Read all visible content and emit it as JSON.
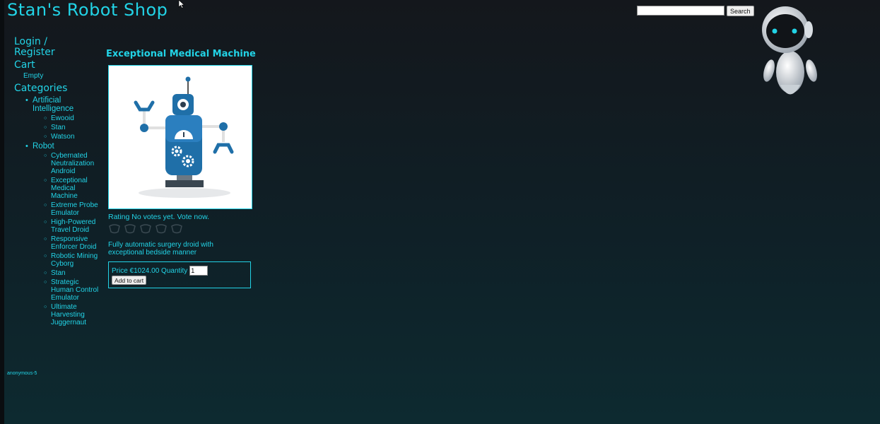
{
  "header": {
    "site_title": "Stan's Robot Shop",
    "search_placeholder": "",
    "search_button": "Search"
  },
  "sidebar": {
    "login": "Login / Register",
    "cart_label": "Cart",
    "cart_status": "Empty",
    "categories_label": "Categories",
    "categories": [
      {
        "label": "Artificial Intelligence",
        "items": [
          "Ewooid",
          "Stan",
          "Watson"
        ]
      },
      {
        "label": "Robot",
        "items": [
          "Cybernated Neutralization Android",
          "Exceptional Medical Machine",
          "Extreme Probe Emulator",
          "High-Powered Travel Droid",
          "Responsive Enforcer Droid",
          "Robotic Mining Cyborg",
          "Stan",
          "Strategic Human Control Emulator",
          "Ultimate Harvesting Juggernaut"
        ]
      }
    ]
  },
  "user": {
    "name": "anonymous-5"
  },
  "product": {
    "title": "Exceptional Medical Machine",
    "rating_text": "Rating No votes yet. Vote now.",
    "stars_total": 5,
    "description": "Fully automatic surgery droid with exceptional bedside manner",
    "price_text": "Price €1024.00 Quantity",
    "quantity": "1",
    "add_to_cart": "Add to cart"
  },
  "colors": {
    "accent": "#22d3e6",
    "robot_blue": "#1f6fa8"
  }
}
